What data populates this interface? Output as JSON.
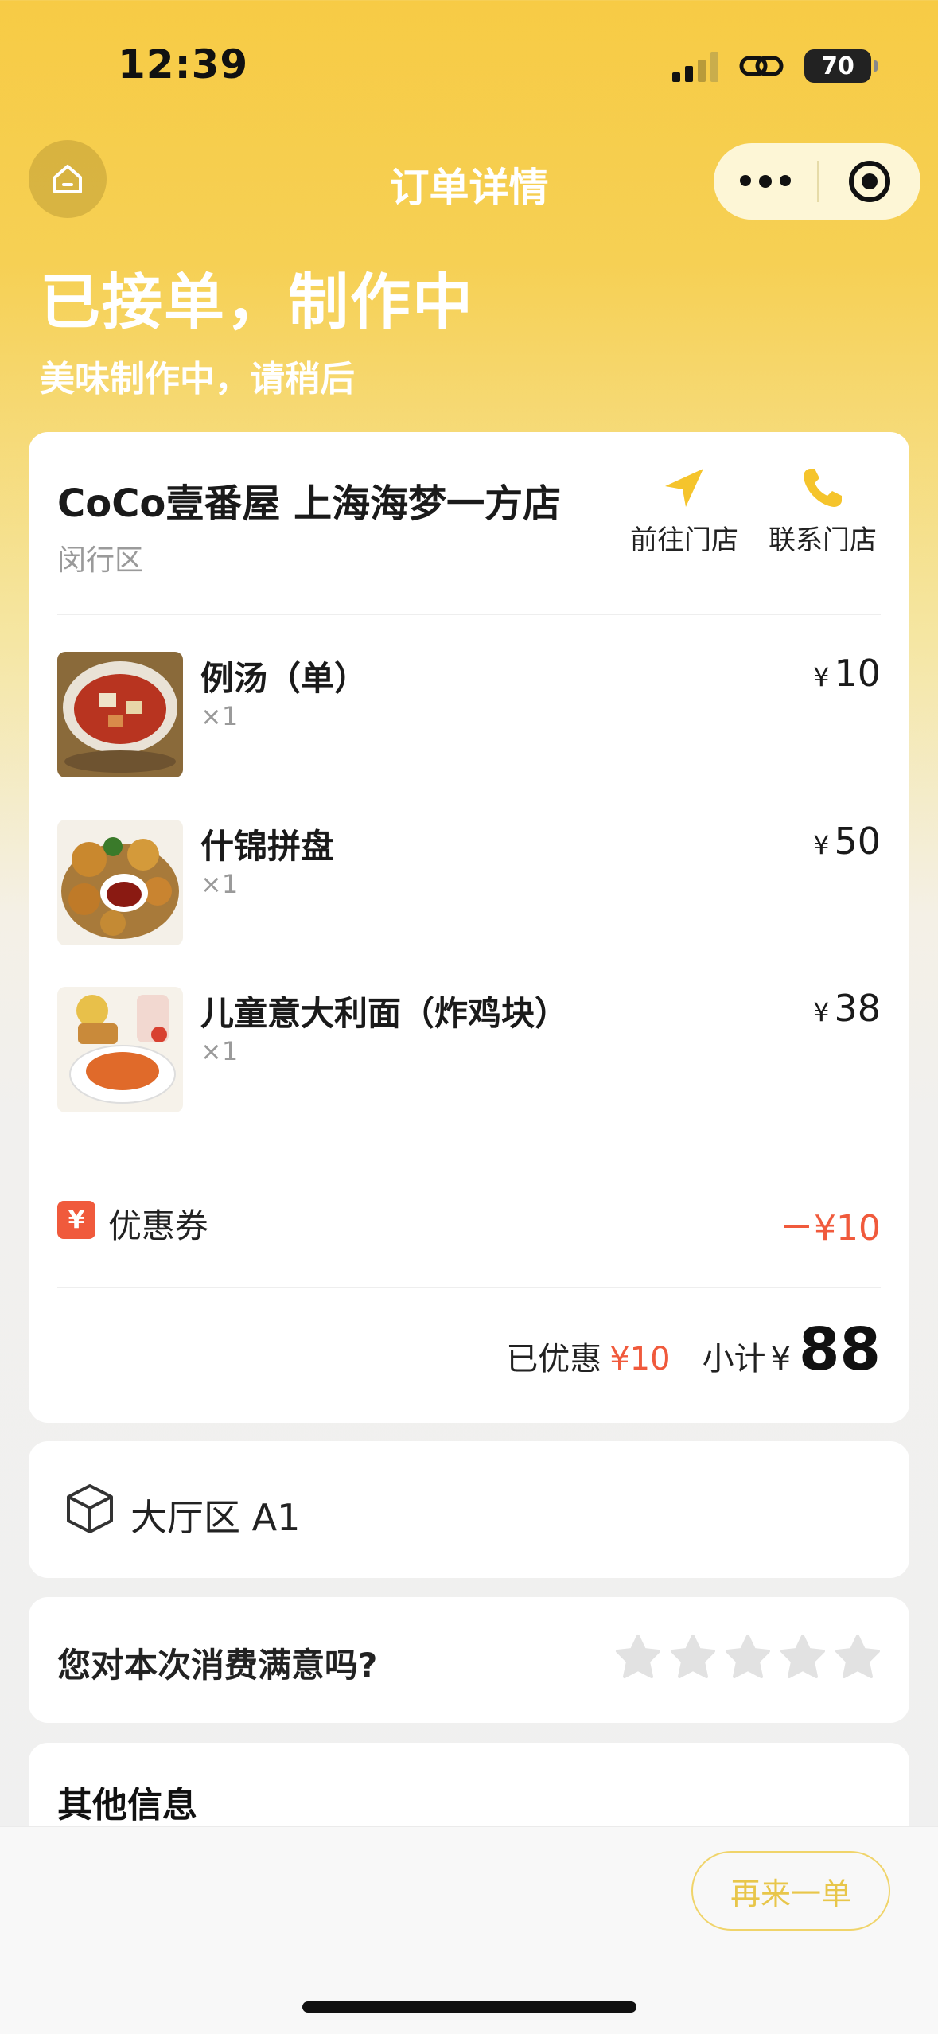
{
  "status_bar": {
    "time": "12:39",
    "battery": "70"
  },
  "nav": {
    "title": "订单详情"
  },
  "header": {
    "status": "已接单，制作中",
    "subtitle": "美味制作中，请稍后"
  },
  "store": {
    "name": "CoCo壹番屋 上海海梦一方店",
    "area": "闵行区",
    "go_label": "前往门店",
    "call_label": "联系门店"
  },
  "items": [
    {
      "name": "例汤（单）",
      "qty": "×1",
      "currency": "¥",
      "price": "10"
    },
    {
      "name": "什锦拼盘",
      "qty": "×1",
      "currency": "¥",
      "price": "50"
    },
    {
      "name": "儿童意大利面（炸鸡块）",
      "qty": "×1",
      "currency": "¥",
      "price": "38"
    }
  ],
  "coupon": {
    "icon": "¥",
    "label": "优惠券",
    "amount": "－¥10"
  },
  "summary": {
    "saved_label": "已优惠",
    "saved_amount": "¥10",
    "subtotal_label": "小计",
    "currency": "¥",
    "total": "88"
  },
  "table": {
    "label": "大厅区 A1"
  },
  "rating": {
    "question": "您对本次消费满意吗?",
    "stars": 5
  },
  "other": {
    "title": "其他信息"
  },
  "bottom": {
    "reorder_label": "再来一单"
  },
  "colors": {
    "brand_yellow": "#f7cb45",
    "discount_red": "#f05a3c",
    "button_outline": "#f0d46a"
  }
}
